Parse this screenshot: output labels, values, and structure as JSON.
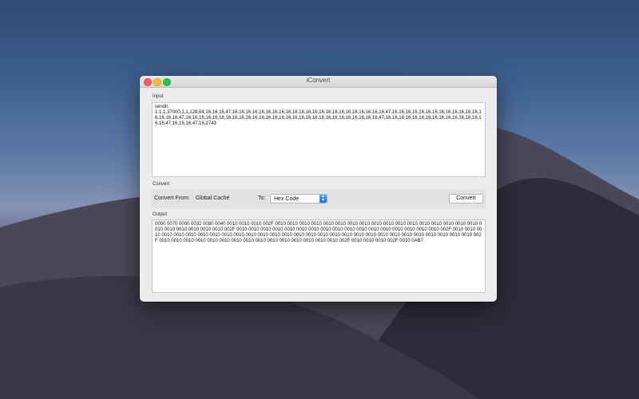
{
  "window": {
    "title": "iConvert"
  },
  "input": {
    "label": "Input",
    "text": "sendir,\n1:1,1,37000,1,1,128,64,16,16,16,47,16,16,16,16,16,16,16,16,16,16,16,16,16,16,16,16,16,16,16,16,16,16,16,47,16,16,16,16,16,16,16,16,16,16,16,16,16,16,16,16,16,47,16,16,16,16,16,16,16,16,16,16,16,16,16,16,16,16,16,16,16,16,16,16,16,16,16,16,16,16,16,47,16,16,16,16,16,16,16,16,16,16,16,16,16,16,16,16,47,16,16,16,47,16,2743"
  },
  "convert": {
    "label": "Convert",
    "from_label": "Convert From:",
    "from_value": "Global Caché",
    "to_label": "To:",
    "to_value": "Hex Code",
    "button_label": "Convert"
  },
  "output": {
    "label": "Output",
    "text": "0000 0070 0000 0032 0080 0040 0010 0010 0010 002F 0010 0010 0010 0010 0010 0010 0010 0010 0010 0010 0010 0010 0010 0010 0010 0010 0010 0010 0010 0010 0010 0010 0010 002F 0010 0010 0010 0010 0010 0010 0010 0010 0010 0010 0010 0010 0010 0010 0010 0010 0010 002F 0010 0010 0010 0010 0010 0010 0010 0010 0010 0010 0010 0010 0010 0010 0010 0010 0010 0010 0010 0010 0010 0010 0010 0010 0010 0010 0010 0010 0010 002F 0010 0010 0010 0010 0010 0010 0010 0010 0010 0010 0010 0010 0010 0010 0010 002F 0010 0010 0010 002F 0010 0AB7"
  }
}
